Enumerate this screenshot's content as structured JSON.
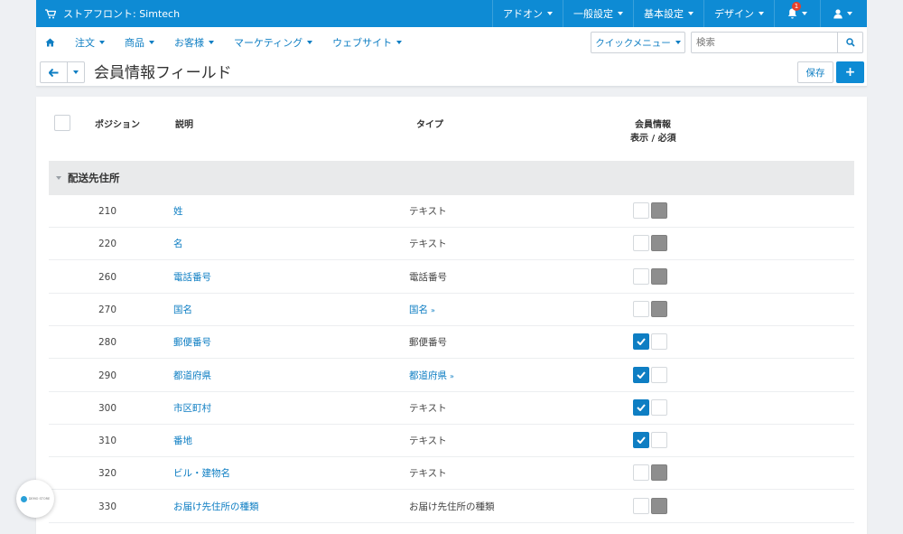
{
  "topbar": {
    "store_label": "ストアフロント: Simtech",
    "menus": [
      "アドオン",
      "一般設定",
      "基本設定",
      "デザイン"
    ],
    "notification_count": "1"
  },
  "nav": {
    "items": [
      "注文",
      "商品",
      "お客様",
      "マーケティング",
      "ウェブサイト"
    ],
    "quick_menu": "クイックメニュー",
    "search_placeholder": "検索"
  },
  "page": {
    "title": "会員情報フィールド",
    "save_label": "保存"
  },
  "table": {
    "headers": {
      "position": "ポジション",
      "description": "説明",
      "type": "タイプ",
      "profile_line1": "会員情報",
      "profile_line2": "表示 / 必須"
    },
    "group_title": "配送先住所",
    "rows": [
      {
        "position": "210",
        "description": "姓",
        "type": "テキスト",
        "type_link": false,
        "show": false,
        "required_disabled": true
      },
      {
        "position": "220",
        "description": "名",
        "type": "テキスト",
        "type_link": false,
        "show": false,
        "required_disabled": true
      },
      {
        "position": "260",
        "description": "電話番号",
        "type": "電話番号",
        "type_link": false,
        "show": false,
        "required_disabled": true
      },
      {
        "position": "270",
        "description": "国名",
        "type": "国名",
        "type_link": true,
        "show": false,
        "required_disabled": true
      },
      {
        "position": "280",
        "description": "郵便番号",
        "type": "郵便番号",
        "type_link": false,
        "show": true,
        "required_disabled": false
      },
      {
        "position": "290",
        "description": "都道府県",
        "type": "都道府県",
        "type_link": true,
        "show": true,
        "required_disabled": false
      },
      {
        "position": "300",
        "description": "市区町村",
        "type": "テキスト",
        "type_link": false,
        "show": true,
        "required_disabled": false
      },
      {
        "position": "310",
        "description": "番地",
        "type": "テキスト",
        "type_link": false,
        "show": true,
        "required_disabled": false
      },
      {
        "position": "320",
        "description": "ビル・建物名",
        "type": "テキスト",
        "type_link": false,
        "show": false,
        "required_disabled": true
      },
      {
        "position": "330",
        "description": "お届け先住所の種類",
        "type": "お届け先住所の種類",
        "type_link": false,
        "show": false,
        "required_disabled": true
      }
    ]
  },
  "demo_badge": {
    "text": "DEMO STORE"
  },
  "colors": {
    "accent": "#0e8bd4",
    "link": "#0e7ec3",
    "group_bg": "#e9eaeb",
    "disabled_box": "#8e8e8e"
  }
}
